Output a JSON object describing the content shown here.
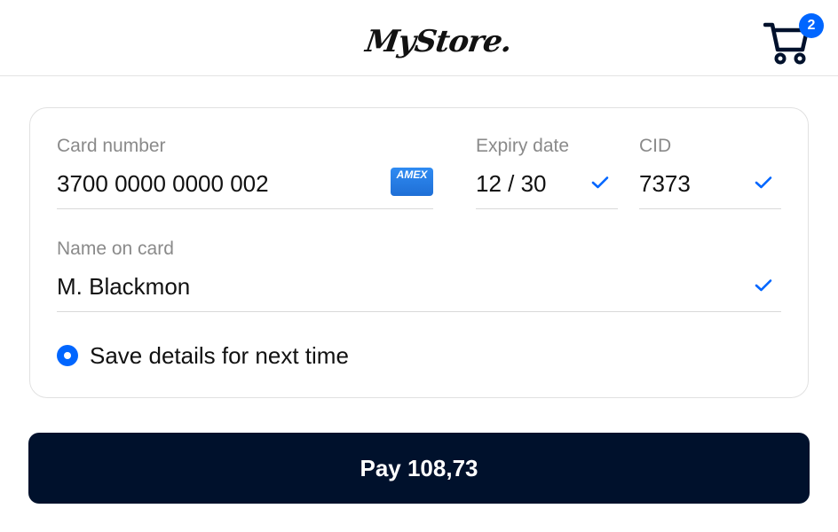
{
  "header": {
    "logo_text": "MyStore.",
    "cart_count": "2"
  },
  "form": {
    "card_number": {
      "label": "Card number",
      "value": "3700 0000 0000 002",
      "brand_text": "AMEX"
    },
    "expiry": {
      "label": "Expiry date",
      "value": "12 / 30"
    },
    "cid": {
      "label": "CID",
      "value": "7373"
    },
    "name": {
      "label": "Name on card",
      "value": "M. Blackmon"
    },
    "save_details_label": "Save details for next time"
  },
  "pay_button": {
    "label": "Pay 108,73"
  },
  "colors": {
    "accent": "#0066ff",
    "button_bg": "#00112c"
  },
  "icons": {
    "cart": "shopping-cart-icon",
    "check": "check-icon",
    "card_brand": "amex-card-icon"
  }
}
